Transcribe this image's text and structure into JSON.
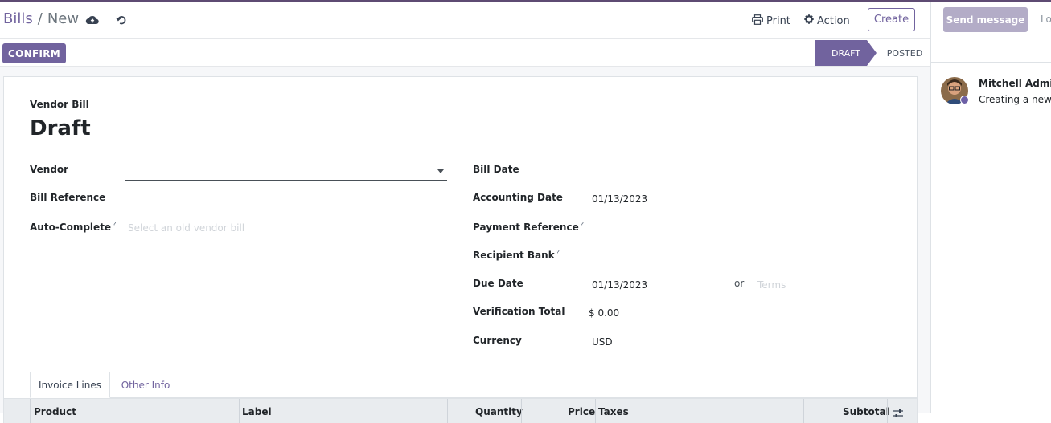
{
  "breadcrumb": {
    "parent": "Bills",
    "separator": "/",
    "current": "New"
  },
  "header": {
    "print_label": "Print",
    "action_label": "Action",
    "create_label": "Create"
  },
  "statusbar": {
    "confirm_label": "CONFIRM",
    "stages": [
      "DRAFT",
      "POSTED"
    ],
    "active_stage": "DRAFT"
  },
  "form": {
    "type_label": "Vendor Bill",
    "name": "Draft",
    "left": {
      "vendor_label": "Vendor",
      "vendor_value": "",
      "bill_reference_label": "Bill Reference",
      "auto_complete_label": "Auto-Complete",
      "auto_complete_placeholder": "Select an old vendor bill"
    },
    "right": {
      "bill_date_label": "Bill Date",
      "accounting_date_label": "Accounting Date",
      "accounting_date_value": "01/13/2023",
      "payment_reference_label": "Payment Reference",
      "recipient_bank_label": "Recipient Bank",
      "due_date_label": "Due Date",
      "due_date_value": "01/13/2023",
      "or_text": "or",
      "terms_placeholder": "Terms",
      "verification_total_label": "Verification Total",
      "verification_total_value": "$ 0.00",
      "currency_label": "Currency",
      "currency_value": "USD"
    },
    "help_marker": "?"
  },
  "tabs": [
    "Invoice Lines",
    "Other Info"
  ],
  "table": {
    "columns": [
      "Product",
      "Label",
      "Quantity",
      "Price",
      "Taxes",
      "Subtotal"
    ]
  },
  "chatter": {
    "send_message_label": "Send message",
    "log_note_label": "Lo",
    "author": "Mitchell Admin",
    "message": "Creating a new"
  },
  "colors": {
    "brand": "#71639e",
    "brand_light": "#b3acc7",
    "online": "#6c5fa6"
  },
  "icons": [
    "cloud-save-icon",
    "discard-icon",
    "print-icon",
    "gear-icon",
    "dropdown-caret-icon",
    "column-settings-icon"
  ]
}
